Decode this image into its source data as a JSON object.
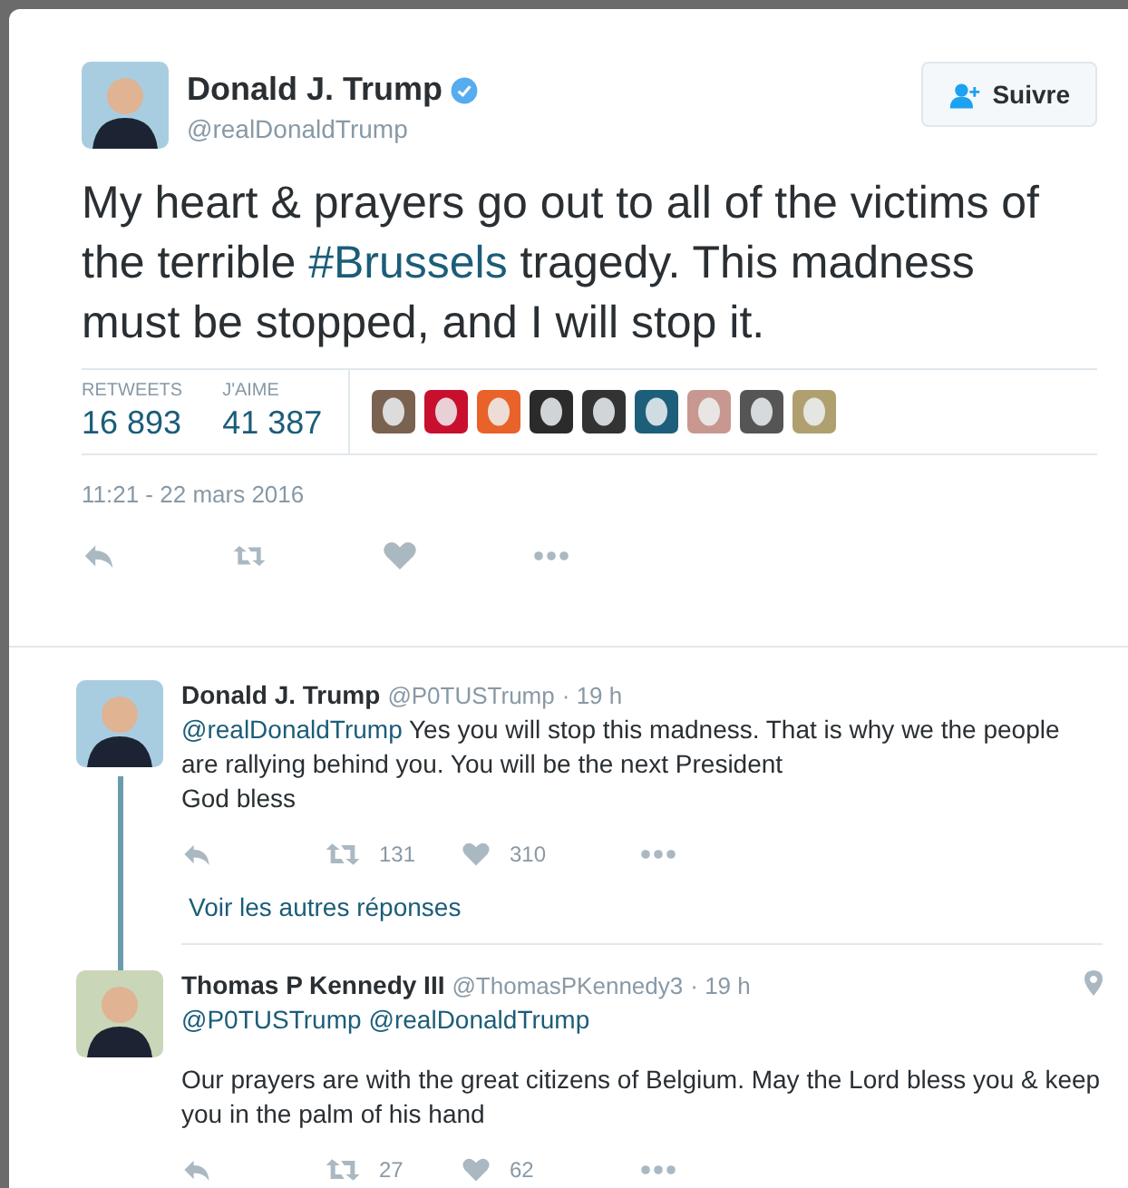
{
  "tweet": {
    "author": {
      "name": "Donald J. Trump",
      "handle": "@realDonaldTrump",
      "verified": true
    },
    "follow_button": "Suivre",
    "text": [
      {
        "kind": "text",
        "text": "My heart & prayers go out to all of the victims of the terrible "
      },
      {
        "kind": "hashtag",
        "text": "#Brussels"
      },
      {
        "kind": "text",
        "text": " tragedy. This madness must be stopped, and I will stop it."
      }
    ],
    "stats": [
      {
        "label": "RETWEETS",
        "value": "16 893"
      },
      {
        "label": "J'AIME",
        "value": "41 387"
      }
    ],
    "likers": [
      {
        "color": "#7a6250"
      },
      {
        "color": "#c8102e"
      },
      {
        "color": "#e8622a"
      },
      {
        "color": "#2b2b2b"
      },
      {
        "color": "#333333"
      },
      {
        "color": "#1d5f7a"
      },
      {
        "color": "#c89890"
      },
      {
        "color": "#555555"
      },
      {
        "color": "#b0a070"
      }
    ],
    "timestamp": "11:21 - 22 mars 2016"
  },
  "replies": [
    {
      "name": "Donald J. Trump",
      "handle": "@P0TUSTrump",
      "time": "· 19 h",
      "location": false,
      "body": [
        {
          "kind": "mention",
          "text": "@realDonaldTrump"
        },
        {
          "kind": "text",
          "text": " Yes you will stop this madness. That is why we the people are rallying behind you. You will be the next President\nGod bless"
        }
      ],
      "retweets": "131",
      "likes": "310",
      "more_link": "Voir les autres réponses",
      "thread": true
    },
    {
      "name": "Thomas P Kennedy III",
      "handle": "@ThomasPKennedy3",
      "time": "· 19 h",
      "location": true,
      "mentions": [
        "@P0TUSTrump",
        "@realDonaldTrump"
      ],
      "body": [
        {
          "kind": "text",
          "text": "Our prayers are with the great citizens of Belgium. May the Lord bless you & keep you in the palm of his hand"
        }
      ],
      "retweets": "27",
      "likes": "62",
      "thread": false
    }
  ]
}
